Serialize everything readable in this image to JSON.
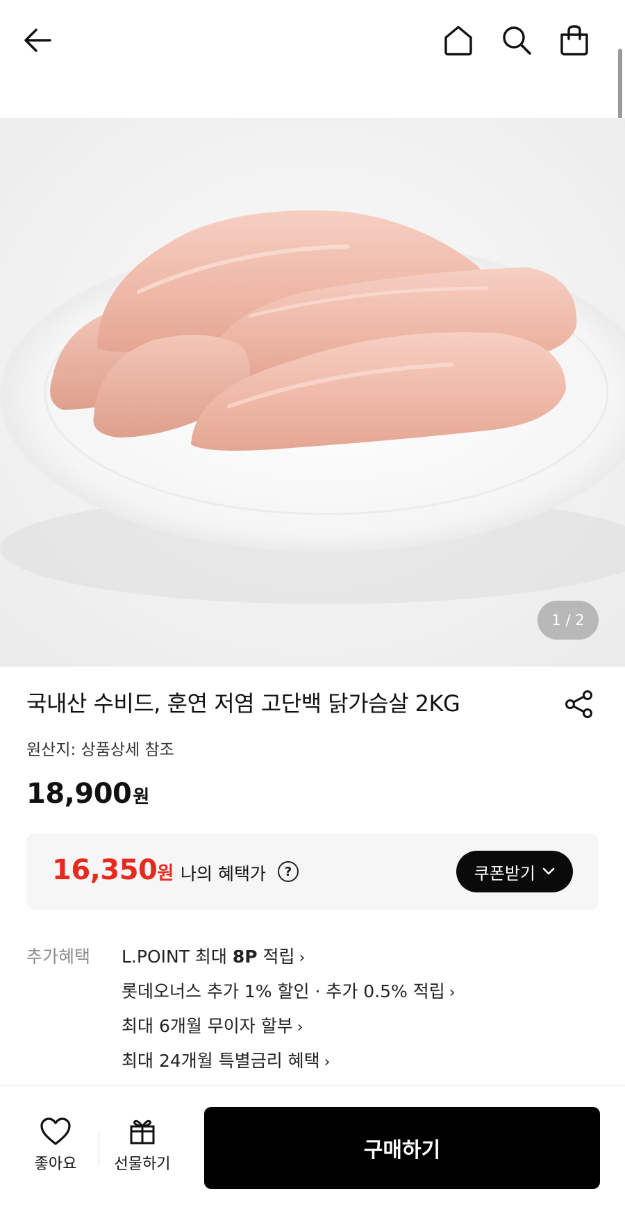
{
  "header": {
    "back_icon": "arrow-left-icon",
    "home_icon": "home-icon",
    "search_icon": "search-icon",
    "bag_icon": "shopping-bag-icon"
  },
  "gallery": {
    "image": "chicken-breast-on-plate",
    "counter": "1 / 2",
    "current": 1,
    "total": 2
  },
  "product": {
    "title": "국내산 수비드, 훈연 저염 고단백 닭가슴살 2KG",
    "origin": "원산지: 상품상세 참조",
    "price_value": "18,900",
    "price_unit": "원",
    "share_icon": "share-icon"
  },
  "benefit": {
    "price_value": "16,350",
    "price_unit": "원",
    "label": "나의 혜택가",
    "help_glyph": "?",
    "coupon_label": "쿠폰받기",
    "accent_color": "#e8291d"
  },
  "extras": {
    "label": "추가혜택",
    "items": [
      {
        "pre": "L.POINT 최대 ",
        "bold": "8P",
        "post": " 적립"
      },
      {
        "pre": "롯데오너스 추가 1% 할인 · 추가 0.5% 적립",
        "bold": "",
        "post": ""
      },
      {
        "pre": "최대 6개월 무이자 할부",
        "bold": "",
        "post": ""
      },
      {
        "pre": "최대 24개월 특별금리 혜택",
        "bold": "",
        "post": ""
      }
    ]
  },
  "bottom_bar": {
    "like_label": "좋아요",
    "gift_label": "선물하기",
    "buy_label": "구매하기"
  }
}
